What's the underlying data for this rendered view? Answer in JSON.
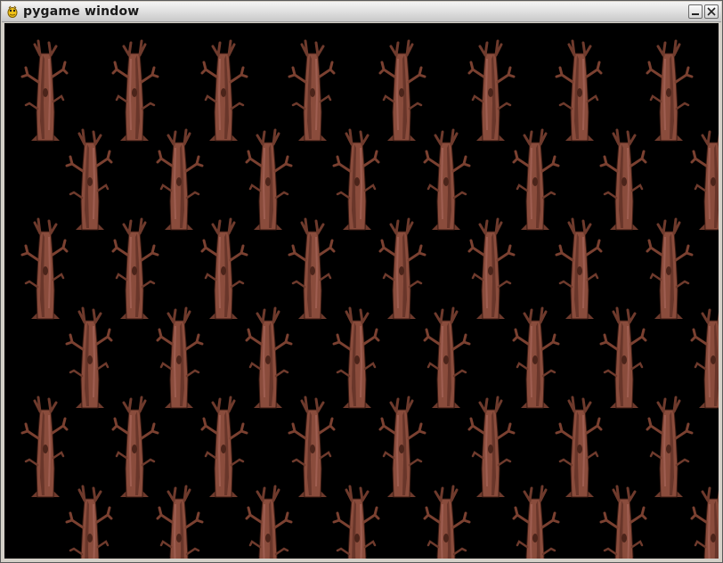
{
  "window": {
    "title": "pygame window",
    "icon": "pygame-snake-icon",
    "controls": [
      {
        "name": "minimize",
        "icon": "minimize-icon"
      },
      {
        "name": "close",
        "icon": "close-icon"
      }
    ]
  },
  "scene": {
    "background": "#000000",
    "sprite": "dead-tree",
    "sprite_colors": {
      "trunk": "#8a4c3c",
      "shadow": "#5e2f24",
      "highlight": "#a8665a",
      "outline": "#3a1a12"
    },
    "rows": [
      {
        "offset": 0,
        "count": 8
      },
      {
        "offset": 1,
        "count": 8
      },
      {
        "offset": 0,
        "count": 8
      },
      {
        "offset": 1,
        "count": 8
      },
      {
        "offset": 0,
        "count": 8
      },
      {
        "offset": 1,
        "count": 8
      }
    ]
  }
}
